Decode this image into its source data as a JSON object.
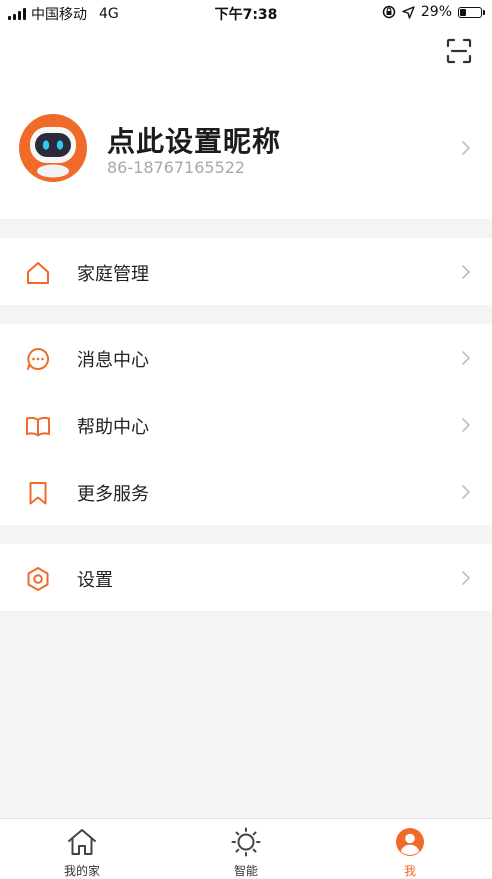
{
  "status_bar": {
    "carrier": "中国移动",
    "network": "4G",
    "time": "下午7:38",
    "battery_percent": "29%",
    "battery_level": 0.29
  },
  "header": {
    "scan_icon": "scan-icon"
  },
  "profile": {
    "nickname": "点此设置昵称",
    "phone": "86-18767165522",
    "avatar_icon": "robot-avatar"
  },
  "menu": {
    "group1": [
      {
        "label": "家庭管理",
        "icon": "home-icon"
      }
    ],
    "group2": [
      {
        "label": "消息中心",
        "icon": "message-icon"
      },
      {
        "label": "帮助中心",
        "icon": "book-icon"
      },
      {
        "label": "更多服务",
        "icon": "bookmark-icon"
      }
    ],
    "group3": [
      {
        "label": "设置",
        "icon": "settings-icon"
      }
    ]
  },
  "tabbar": {
    "tabs": [
      {
        "label": "我的家",
        "icon": "home-icon"
      },
      {
        "label": "智能",
        "icon": "sun-icon"
      },
      {
        "label": "我",
        "icon": "person-icon"
      }
    ],
    "active_index": 2
  },
  "colors": {
    "accent": "#f06a29",
    "background": "#f4f4f4",
    "card": "#ffffff",
    "secondary_text": "#a8a8a8"
  }
}
